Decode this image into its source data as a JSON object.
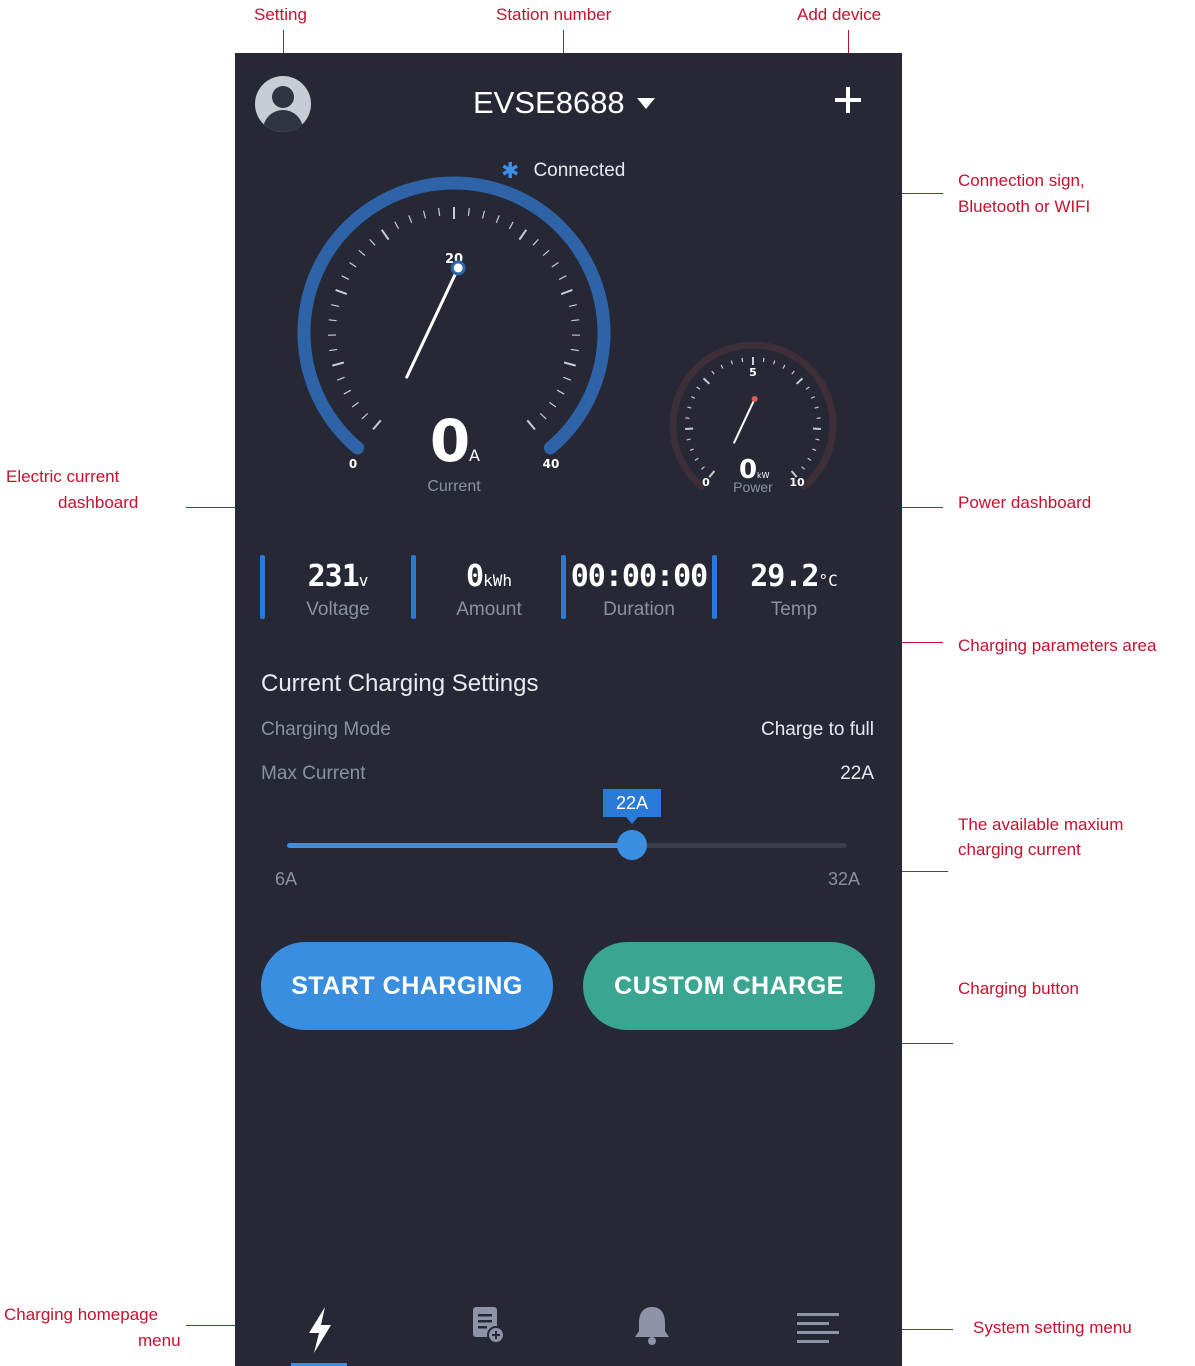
{
  "callouts": {
    "setting": "Setting",
    "station_number": "Station number",
    "add_device": "Add device",
    "connection_line1": "Connection sign,",
    "connection_line2": "Bluetooth or WIFI",
    "current_dashboard_line1": "Electric current",
    "current_dashboard_line2": "dashboard",
    "power_dashboard": "Power dashboard",
    "charging_parameters": "Charging parameters area",
    "max_current_line1": "The available maxium",
    "max_current_line2": "charging current",
    "charging_button": "Charging button",
    "homepage_menu_line1": "Charging homepage",
    "homepage_menu_line2": "menu",
    "system_menu": "System setting menu"
  },
  "header": {
    "station_name": "EVSE8688",
    "connection_status": "Connected",
    "connection_icon": "bluetooth-icon"
  },
  "current_gauge": {
    "value": "0",
    "unit": "A",
    "label": "Current",
    "min_label": "0",
    "mid_label": "20",
    "max_label": "40",
    "reading": 0,
    "min": 0,
    "max": 40
  },
  "power_gauge": {
    "value": "0",
    "unit": "kW",
    "label": "Power",
    "min_label": "0",
    "mid_label": "5",
    "max_label": "10",
    "reading": 0,
    "min": 0,
    "max": 10
  },
  "params": [
    {
      "value": "231",
      "unit": "v",
      "label": "Voltage"
    },
    {
      "value": "0",
      "unit": "kWh",
      "label": "Amount"
    },
    {
      "value": "00:00:00",
      "unit": "",
      "label": "Duration"
    },
    {
      "value": "29.2",
      "unit": "°C",
      "label": "Temp"
    }
  ],
  "settings": {
    "title": "Current Charging Settings",
    "mode_label": "Charging Mode",
    "mode_value": "Charge to full",
    "max_current_label": "Max Current",
    "max_current_value": "22A"
  },
  "slider": {
    "tooltip": "22A",
    "min_label": "6A",
    "max_label": "32A",
    "value": 22,
    "min": 6,
    "max": 32
  },
  "buttons": {
    "start": "START CHARGING",
    "custom": "CUSTOM CHARGE"
  },
  "nav": {
    "items": [
      "lightning-icon",
      "document-add-icon",
      "bell-icon",
      "menu-lines-icon"
    ],
    "active_index": 0
  },
  "colors": {
    "background": "#262835",
    "accent_blue": "#3a8ee0",
    "accent_teal": "#3aa590",
    "annotation_red": "#c8102e"
  }
}
